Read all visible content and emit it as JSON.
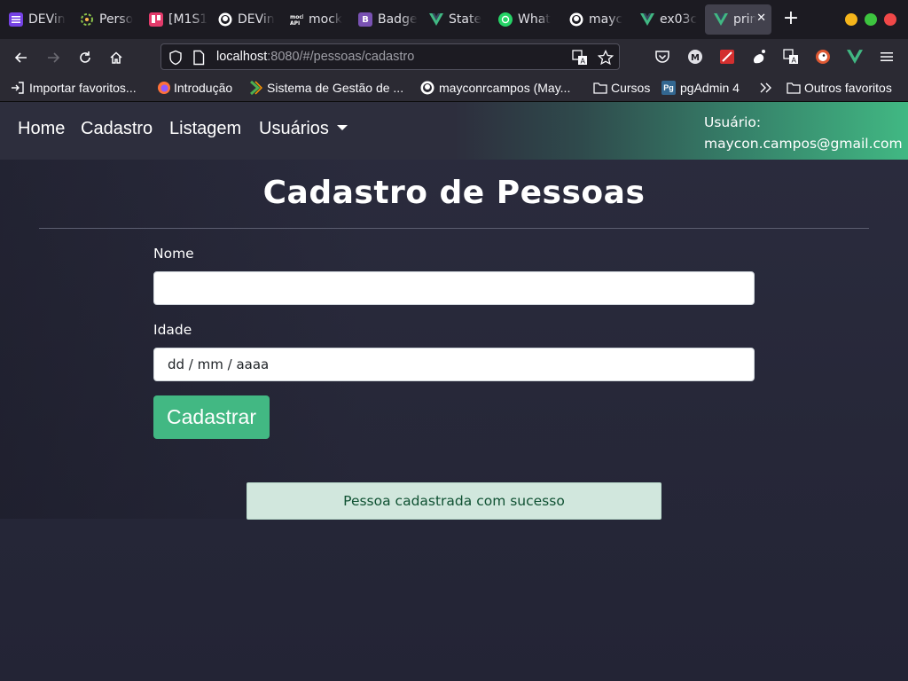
{
  "browser": {
    "tabs": [
      {
        "label": "DEVin",
        "icon": "list-icon",
        "color": "#7542e5"
      },
      {
        "label": "Perso",
        "icon": "project-icon",
        "color": "#3f3f46"
      },
      {
        "label": "[M1S1",
        "icon": "trello-icon",
        "color": "#e33b6b"
      },
      {
        "label": "DEVin",
        "icon": "github-icon",
        "color": "#1c1b22"
      },
      {
        "label": "mock",
        "icon": "mock-api-icon",
        "color": "#1c1b22"
      },
      {
        "label": "Badge",
        "icon": "bootstrap-icon",
        "color": "#7952b3"
      },
      {
        "label": "State",
        "icon": "vue-icon",
        "color": "#41b883"
      },
      {
        "label": "What",
        "icon": "whatsapp-icon",
        "color": "#25d366"
      },
      {
        "label": "mayc",
        "icon": "github-icon",
        "color": "#1c1b22"
      },
      {
        "label": "ex03c",
        "icon": "vue-icon",
        "color": "#41b883"
      },
      {
        "label": "prin",
        "icon": "vue-icon",
        "color": "#41b883",
        "active": true
      }
    ],
    "url": {
      "host": "localhost",
      "rest": ":8080/#/pessoas/cadastro"
    },
    "bookmarks": [
      {
        "label": "Importar favoritos...",
        "icon": "import-icon"
      },
      {
        "label": "Introdução",
        "icon": "firefox-icon"
      },
      {
        "label": "Sistema de Gestão de ...",
        "icon": "sistema-icon"
      },
      {
        "label": "mayconrcampos (May...",
        "icon": "github-icon"
      },
      {
        "label": "Cursos",
        "icon": "folder-icon"
      },
      {
        "label": "pgAdmin 4",
        "icon": "pgadmin-icon"
      },
      {
        "label": "Outros favoritos",
        "icon": "folder-icon"
      }
    ]
  },
  "app": {
    "nav": {
      "home": "Home",
      "cadastro": "Cadastro",
      "listagem": "Listagem",
      "usuarios": "Usuários"
    },
    "user": {
      "label": "Usuário:",
      "email": "maycon.campos@gmail.com"
    },
    "title": "Cadastro de Pessoas",
    "form": {
      "nome_label": "Nome",
      "nome_value": "",
      "idade_label": "Idade",
      "idade_value": "dd / mm / aaaa",
      "submit_label": "Cadastrar"
    },
    "alert": "Pessoa cadastrada com sucesso"
  },
  "colors": {
    "accent": "#42b883",
    "alert_bg": "#d1e7dd",
    "alert_text": "#0f5132"
  }
}
